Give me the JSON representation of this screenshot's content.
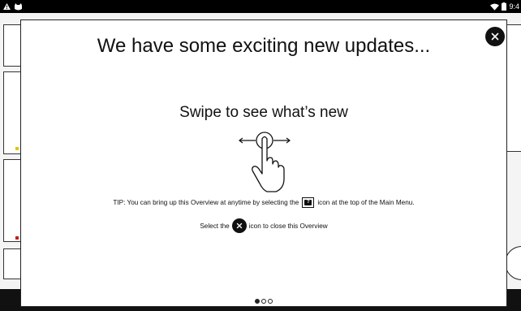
{
  "status_bar": {
    "time": "9:4",
    "icons": [
      "warning-icon",
      "cat-icon",
      "wifi-icon",
      "battery-icon"
    ]
  },
  "overview": {
    "headline": "We have some exciting new updates...",
    "subhead": "Swipe to see what’s new",
    "tip_before": "TIP: You can bring up this Overview at anytime by selecting the",
    "tip_after": "icon at the top of the Main Menu.",
    "select_before": "Select the",
    "select_after": "icon to close this Overview",
    "close_button_icon": "close-icon",
    "gesture_icon": "swipe-hand-icon",
    "pager": {
      "page_count": 3,
      "active_index": 0
    }
  },
  "colors": {
    "status_bar": "#000000",
    "modal_bg": "#ffffff",
    "text": "#111111",
    "accent_yellow": "#e6c200",
    "accent_red": "#c02020"
  }
}
